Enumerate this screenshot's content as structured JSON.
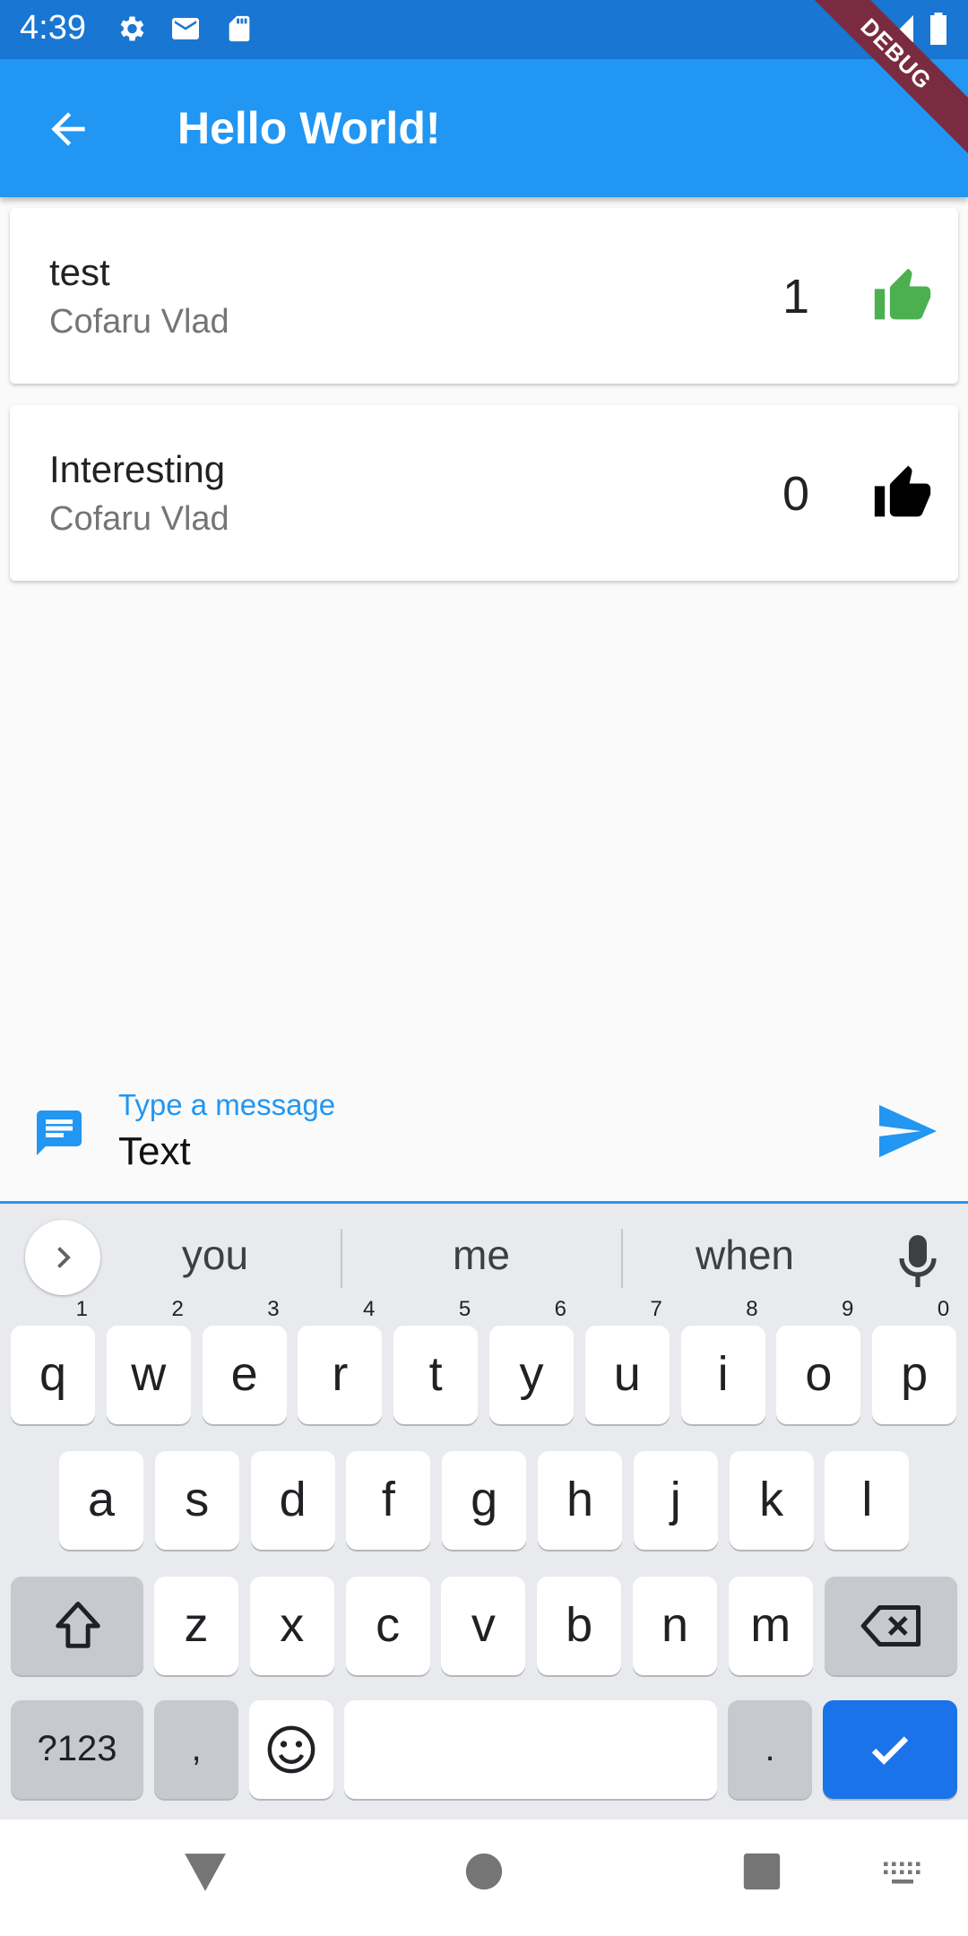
{
  "status_bar": {
    "time": "4:39",
    "icons": [
      "settings-icon",
      "gmail-icon",
      "sd-card-icon",
      "wifi-icon",
      "signal-icon",
      "battery-icon"
    ],
    "debug_label": "DEBUG"
  },
  "app_bar": {
    "title": "Hello World!",
    "color": "#2196f3"
  },
  "messages": [
    {
      "text": "test",
      "author": "Cofaru Vlad",
      "likes": "1",
      "liked": true,
      "thumb_color": "#4caf50"
    },
    {
      "text": "Interesting",
      "author": "Cofaru Vlad",
      "likes": "0",
      "liked": false,
      "thumb_color": "#000000"
    }
  ],
  "composer": {
    "label": "Type a message",
    "value": "Text"
  },
  "keyboard": {
    "suggestions": [
      "you",
      "me",
      "when"
    ],
    "row1": [
      {
        "k": "q",
        "h": "1"
      },
      {
        "k": "w",
        "h": "2"
      },
      {
        "k": "e",
        "h": "3"
      },
      {
        "k": "r",
        "h": "4"
      },
      {
        "k": "t",
        "h": "5"
      },
      {
        "k": "y",
        "h": "6"
      },
      {
        "k": "u",
        "h": "7"
      },
      {
        "k": "i",
        "h": "8"
      },
      {
        "k": "o",
        "h": "9"
      },
      {
        "k": "p",
        "h": "0"
      }
    ],
    "row2": [
      "a",
      "s",
      "d",
      "f",
      "g",
      "h",
      "j",
      "k",
      "l"
    ],
    "row3": [
      "z",
      "x",
      "c",
      "v",
      "b",
      "n",
      "m"
    ],
    "symbols_label": "?123",
    "comma_label": ",",
    "period_label": "."
  }
}
